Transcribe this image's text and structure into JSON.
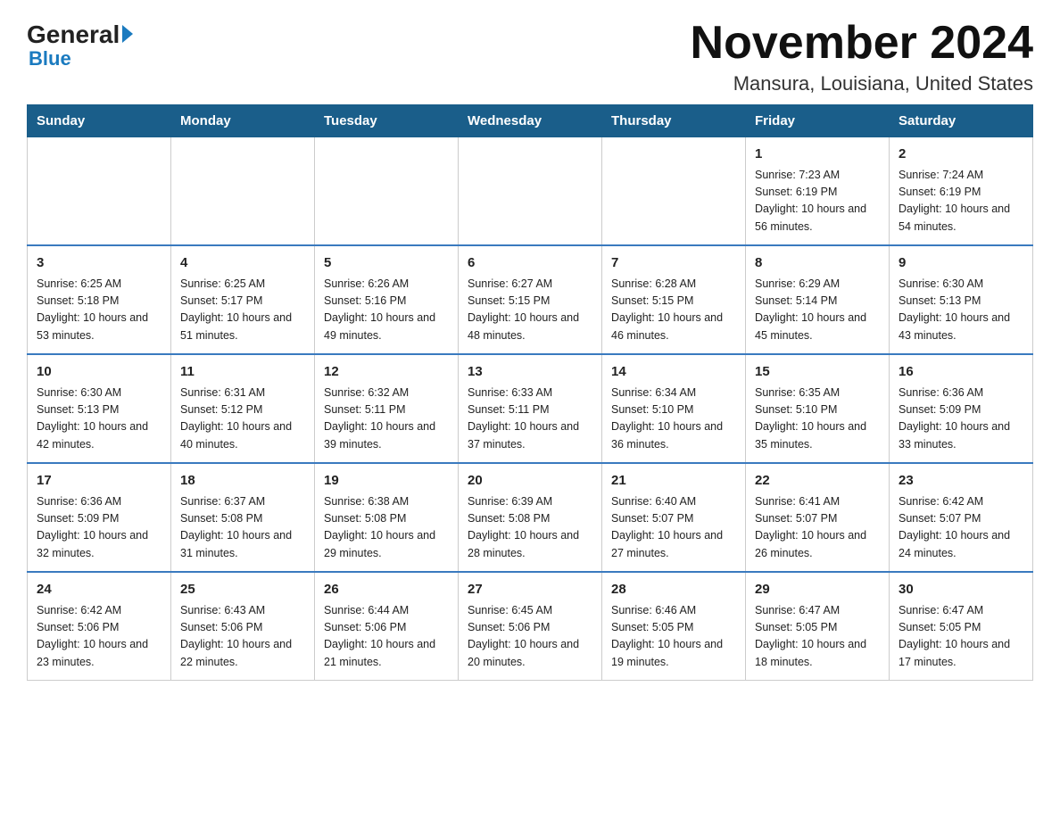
{
  "header": {
    "logo_general": "General",
    "logo_blue": "Blue",
    "month_title": "November 2024",
    "location": "Mansura, Louisiana, United States"
  },
  "days_of_week": [
    "Sunday",
    "Monday",
    "Tuesday",
    "Wednesday",
    "Thursday",
    "Friday",
    "Saturday"
  ],
  "weeks": [
    [
      {
        "day": "",
        "info": ""
      },
      {
        "day": "",
        "info": ""
      },
      {
        "day": "",
        "info": ""
      },
      {
        "day": "",
        "info": ""
      },
      {
        "day": "",
        "info": ""
      },
      {
        "day": "1",
        "info": "Sunrise: 7:23 AM\nSunset: 6:19 PM\nDaylight: 10 hours and 56 minutes."
      },
      {
        "day": "2",
        "info": "Sunrise: 7:24 AM\nSunset: 6:19 PM\nDaylight: 10 hours and 54 minutes."
      }
    ],
    [
      {
        "day": "3",
        "info": "Sunrise: 6:25 AM\nSunset: 5:18 PM\nDaylight: 10 hours and 53 minutes."
      },
      {
        "day": "4",
        "info": "Sunrise: 6:25 AM\nSunset: 5:17 PM\nDaylight: 10 hours and 51 minutes."
      },
      {
        "day": "5",
        "info": "Sunrise: 6:26 AM\nSunset: 5:16 PM\nDaylight: 10 hours and 49 minutes."
      },
      {
        "day": "6",
        "info": "Sunrise: 6:27 AM\nSunset: 5:15 PM\nDaylight: 10 hours and 48 minutes."
      },
      {
        "day": "7",
        "info": "Sunrise: 6:28 AM\nSunset: 5:15 PM\nDaylight: 10 hours and 46 minutes."
      },
      {
        "day": "8",
        "info": "Sunrise: 6:29 AM\nSunset: 5:14 PM\nDaylight: 10 hours and 45 minutes."
      },
      {
        "day": "9",
        "info": "Sunrise: 6:30 AM\nSunset: 5:13 PM\nDaylight: 10 hours and 43 minutes."
      }
    ],
    [
      {
        "day": "10",
        "info": "Sunrise: 6:30 AM\nSunset: 5:13 PM\nDaylight: 10 hours and 42 minutes."
      },
      {
        "day": "11",
        "info": "Sunrise: 6:31 AM\nSunset: 5:12 PM\nDaylight: 10 hours and 40 minutes."
      },
      {
        "day": "12",
        "info": "Sunrise: 6:32 AM\nSunset: 5:11 PM\nDaylight: 10 hours and 39 minutes."
      },
      {
        "day": "13",
        "info": "Sunrise: 6:33 AM\nSunset: 5:11 PM\nDaylight: 10 hours and 37 minutes."
      },
      {
        "day": "14",
        "info": "Sunrise: 6:34 AM\nSunset: 5:10 PM\nDaylight: 10 hours and 36 minutes."
      },
      {
        "day": "15",
        "info": "Sunrise: 6:35 AM\nSunset: 5:10 PM\nDaylight: 10 hours and 35 minutes."
      },
      {
        "day": "16",
        "info": "Sunrise: 6:36 AM\nSunset: 5:09 PM\nDaylight: 10 hours and 33 minutes."
      }
    ],
    [
      {
        "day": "17",
        "info": "Sunrise: 6:36 AM\nSunset: 5:09 PM\nDaylight: 10 hours and 32 minutes."
      },
      {
        "day": "18",
        "info": "Sunrise: 6:37 AM\nSunset: 5:08 PM\nDaylight: 10 hours and 31 minutes."
      },
      {
        "day": "19",
        "info": "Sunrise: 6:38 AM\nSunset: 5:08 PM\nDaylight: 10 hours and 29 minutes."
      },
      {
        "day": "20",
        "info": "Sunrise: 6:39 AM\nSunset: 5:08 PM\nDaylight: 10 hours and 28 minutes."
      },
      {
        "day": "21",
        "info": "Sunrise: 6:40 AM\nSunset: 5:07 PM\nDaylight: 10 hours and 27 minutes."
      },
      {
        "day": "22",
        "info": "Sunrise: 6:41 AM\nSunset: 5:07 PM\nDaylight: 10 hours and 26 minutes."
      },
      {
        "day": "23",
        "info": "Sunrise: 6:42 AM\nSunset: 5:07 PM\nDaylight: 10 hours and 24 minutes."
      }
    ],
    [
      {
        "day": "24",
        "info": "Sunrise: 6:42 AM\nSunset: 5:06 PM\nDaylight: 10 hours and 23 minutes."
      },
      {
        "day": "25",
        "info": "Sunrise: 6:43 AM\nSunset: 5:06 PM\nDaylight: 10 hours and 22 minutes."
      },
      {
        "day": "26",
        "info": "Sunrise: 6:44 AM\nSunset: 5:06 PM\nDaylight: 10 hours and 21 minutes."
      },
      {
        "day": "27",
        "info": "Sunrise: 6:45 AM\nSunset: 5:06 PM\nDaylight: 10 hours and 20 minutes."
      },
      {
        "day": "28",
        "info": "Sunrise: 6:46 AM\nSunset: 5:05 PM\nDaylight: 10 hours and 19 minutes."
      },
      {
        "day": "29",
        "info": "Sunrise: 6:47 AM\nSunset: 5:05 PM\nDaylight: 10 hours and 18 minutes."
      },
      {
        "day": "30",
        "info": "Sunrise: 6:47 AM\nSunset: 5:05 PM\nDaylight: 10 hours and 17 minutes."
      }
    ]
  ]
}
